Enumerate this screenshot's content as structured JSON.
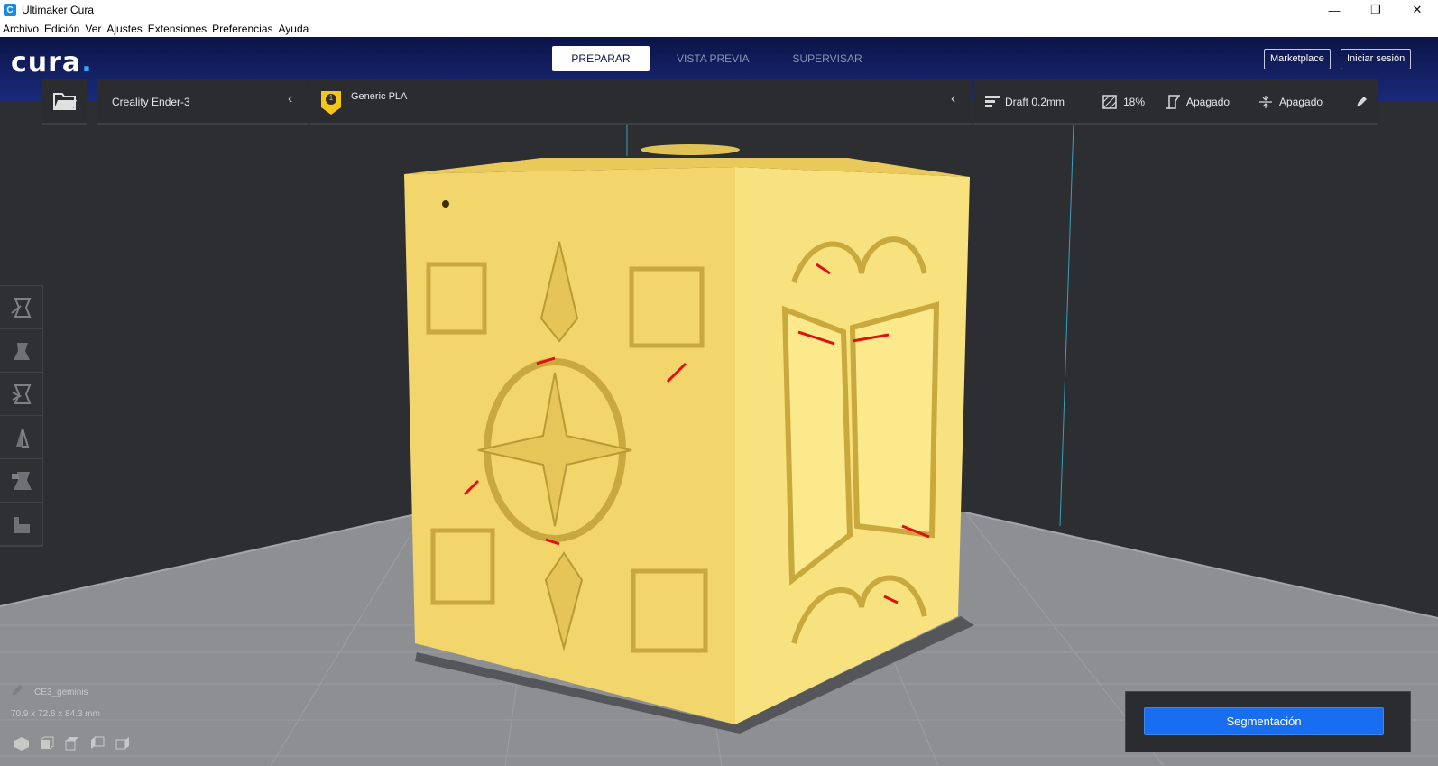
{
  "window": {
    "title": "Ultimaker Cura",
    "app_icon_glyph": "C",
    "controls": {
      "minimize": "—",
      "maximize": "❐",
      "close": "✕"
    }
  },
  "menubar": {
    "items": [
      "Archivo",
      "Edición",
      "Ver",
      "Ajustes",
      "Extensiones",
      "Preferencias",
      "Ayuda"
    ]
  },
  "header": {
    "logo_text": "cura",
    "logo_dot": ".",
    "tabs": [
      {
        "label": "PREPARAR",
        "active": true
      },
      {
        "label": "VISTA PREVIA",
        "active": false
      },
      {
        "label": "SUPERVISAR",
        "active": false
      }
    ],
    "marketplace_label": "Marketplace",
    "signin_label": "Iniciar sesión"
  },
  "stage_menu": {
    "printer": "Creality Ender-3",
    "material_badge": "1",
    "material": "Generic PLA",
    "profile": "Draft 0.2mm",
    "infill": "18%",
    "support": "Apagado",
    "adhesion": "Apagado"
  },
  "sidebar_tools": [
    "move-tool-icon",
    "scale-tool-icon",
    "rotate-tool-icon",
    "mirror-tool-icon",
    "per-model-settings-icon",
    "support-blocker-icon"
  ],
  "object_info": {
    "name": "CE3_geminis",
    "dimensions": "70.9 x 72.6 x 84.3 mm"
  },
  "view_buttons": [
    "3d-view-icon",
    "front-view-icon",
    "top-view-icon",
    "left-view-icon",
    "right-view-icon"
  ],
  "action_panel": {
    "slice_label": "Segmentación"
  },
  "colors": {
    "header_bg": "#0b1448",
    "accent_blue": "#196ef0",
    "model_yellow": "#f5d76a",
    "overhang_red": "#e01010"
  }
}
